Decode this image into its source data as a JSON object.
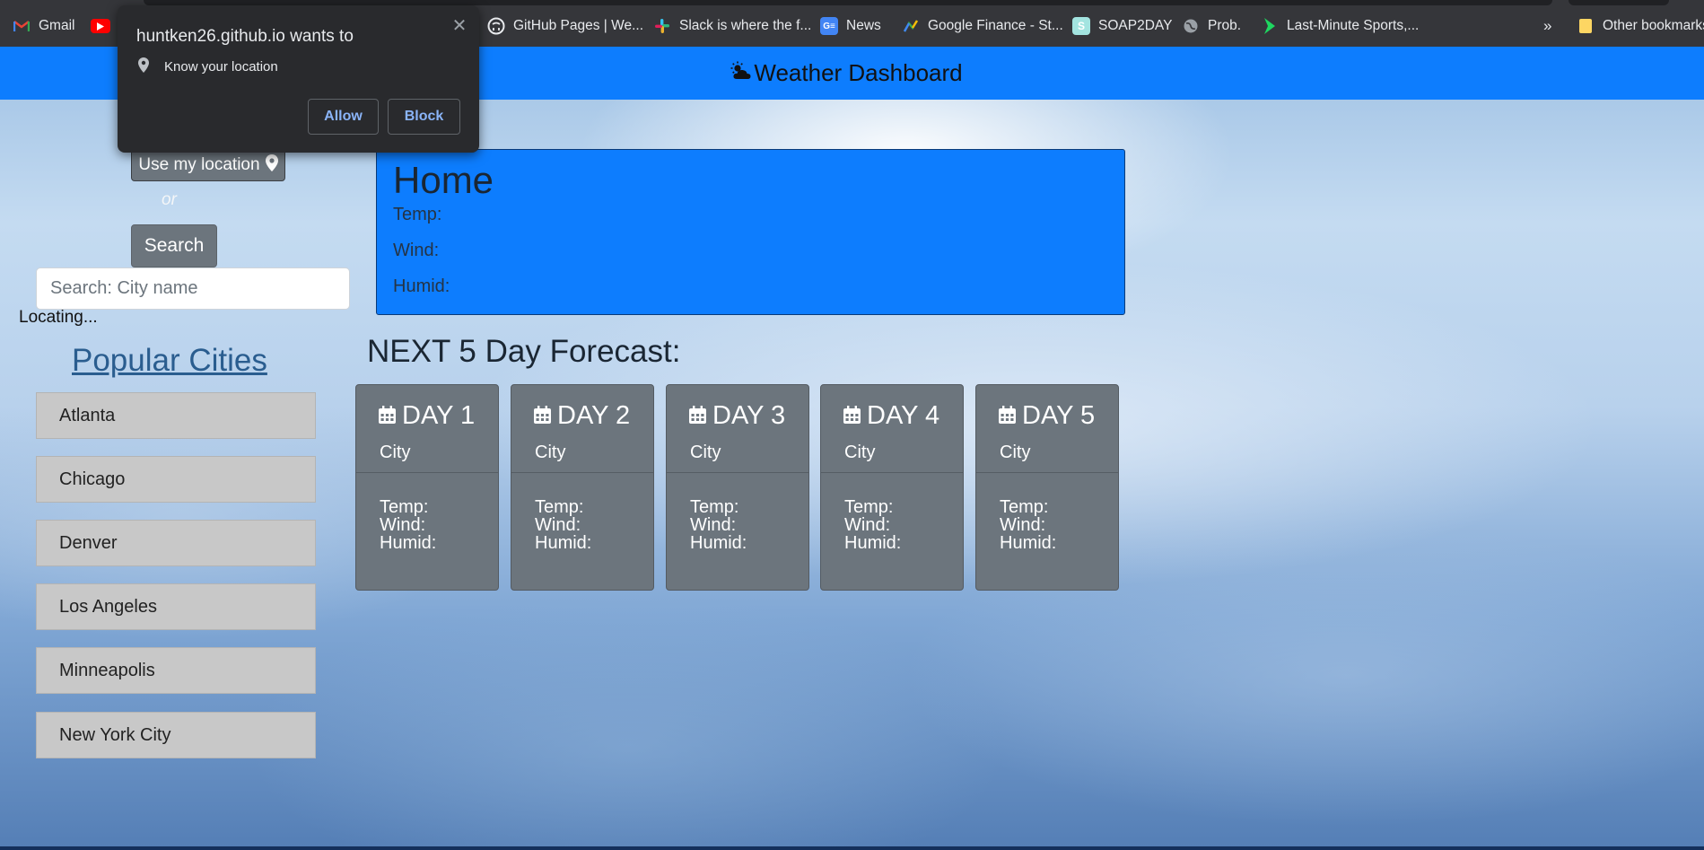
{
  "bookmarks": {
    "items": [
      {
        "label": "Gmail",
        "icon": "gmail-icon"
      },
      {
        "label": "",
        "icon": "youtube-icon"
      },
      {
        "label": "GitHub Pages | We...",
        "icon": "github-icon"
      },
      {
        "label": "Slack is where the f...",
        "icon": "slack-icon"
      },
      {
        "label": "News",
        "icon": "google-news-icon"
      },
      {
        "label": "Google Finance - St...",
        "icon": "google-finance-icon"
      },
      {
        "label": "SOAP2DAY",
        "icon": "soap2day-icon"
      },
      {
        "label": "Prob.",
        "icon": "globe-icon"
      },
      {
        "label": "Last-Minute Sports,...",
        "icon": "chevron-logo-icon"
      }
    ],
    "overflow": "»",
    "other": "Other bookmarks"
  },
  "permission_popup": {
    "title": "huntken26.github.io wants to",
    "request": "Know your location",
    "allow": "Allow",
    "block": "Block",
    "close": "✕"
  },
  "header": {
    "title": "Weather Dashboard",
    "color": "#0d7dfe"
  },
  "sidebar": {
    "use_location": "Use my location",
    "or": "or",
    "search_button": "Search",
    "search_placeholder": "Search: City name",
    "status": "Locating...",
    "popular_title": "Popular Cities",
    "cities": [
      "Atlanta",
      "Chicago",
      "Denver",
      "Los Angeles",
      "Minneapolis",
      "New York City"
    ]
  },
  "home": {
    "title": "Home",
    "temp": "Temp:",
    "wind": "Wind:",
    "humid": "Humid:"
  },
  "forecast": {
    "title": "NEXT 5 Day Forecast:",
    "days": [
      {
        "title": "DAY 1",
        "city": "City",
        "temp": "Temp:",
        "wind": "Wind:",
        "humid": "Humid:"
      },
      {
        "title": "DAY 2",
        "city": "City",
        "temp": "Temp:",
        "wind": "Wind:",
        "humid": "Humid:"
      },
      {
        "title": "DAY 3",
        "city": "City",
        "temp": "Temp:",
        "wind": "Wind:",
        "humid": "Humid:"
      },
      {
        "title": "DAY 4",
        "city": "City",
        "temp": "Temp:",
        "wind": "Wind:",
        "humid": "Humid:"
      },
      {
        "title": "DAY 5",
        "city": "City",
        "temp": "Temp:",
        "wind": "Wind:",
        "humid": "Humid:"
      }
    ]
  }
}
